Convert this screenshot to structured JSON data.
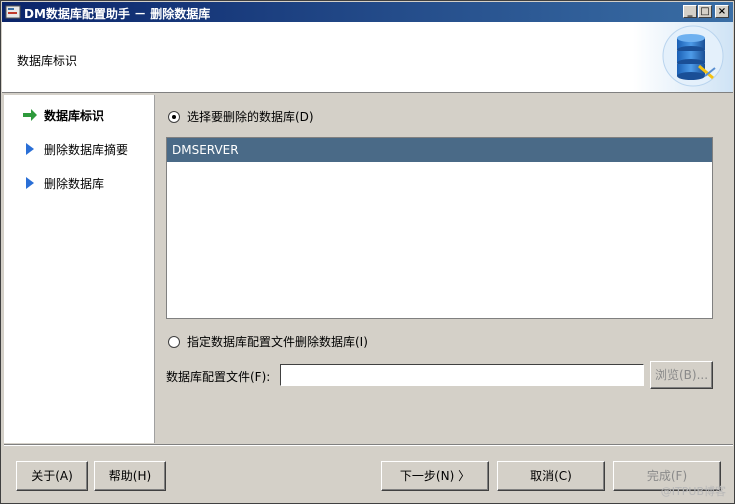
{
  "window": {
    "title": "DM数据库配置助手 － 删除数据库",
    "buttons": {
      "minimize": "_",
      "maximize": "□",
      "close": "×"
    }
  },
  "header": {
    "title": "数据库标识",
    "logo_icon": "database-icon"
  },
  "sidebar": {
    "items": [
      {
        "label": "数据库标识",
        "active": true
      },
      {
        "label": "删除数据库摘要",
        "active": false
      },
      {
        "label": "删除数据库",
        "active": false
      }
    ]
  },
  "main": {
    "option_select": {
      "label": "选择要删除的数据库(D)",
      "checked": true
    },
    "databases": [
      "DMSERVER"
    ],
    "option_file": {
      "label": "指定数据库配置文件删除数据库(I)",
      "checked": false
    },
    "config_file_label": "数据库配置文件(F):",
    "config_file_value": "",
    "browse_button": "浏览(B)..."
  },
  "footer": {
    "about": "关于(A)",
    "help": "帮助(H)",
    "next": "下一步(N) 〉",
    "cancel": "取消(C)",
    "finish": "完成(F)"
  },
  "watermark": "@ITPUB博客",
  "colors": {
    "title_start": "#0a246a",
    "title_end": "#3a6ea5",
    "selection": "#4a6a87",
    "nav_active_arrow": "#2e9a3c",
    "nav_arrow": "#2a6fd6"
  }
}
